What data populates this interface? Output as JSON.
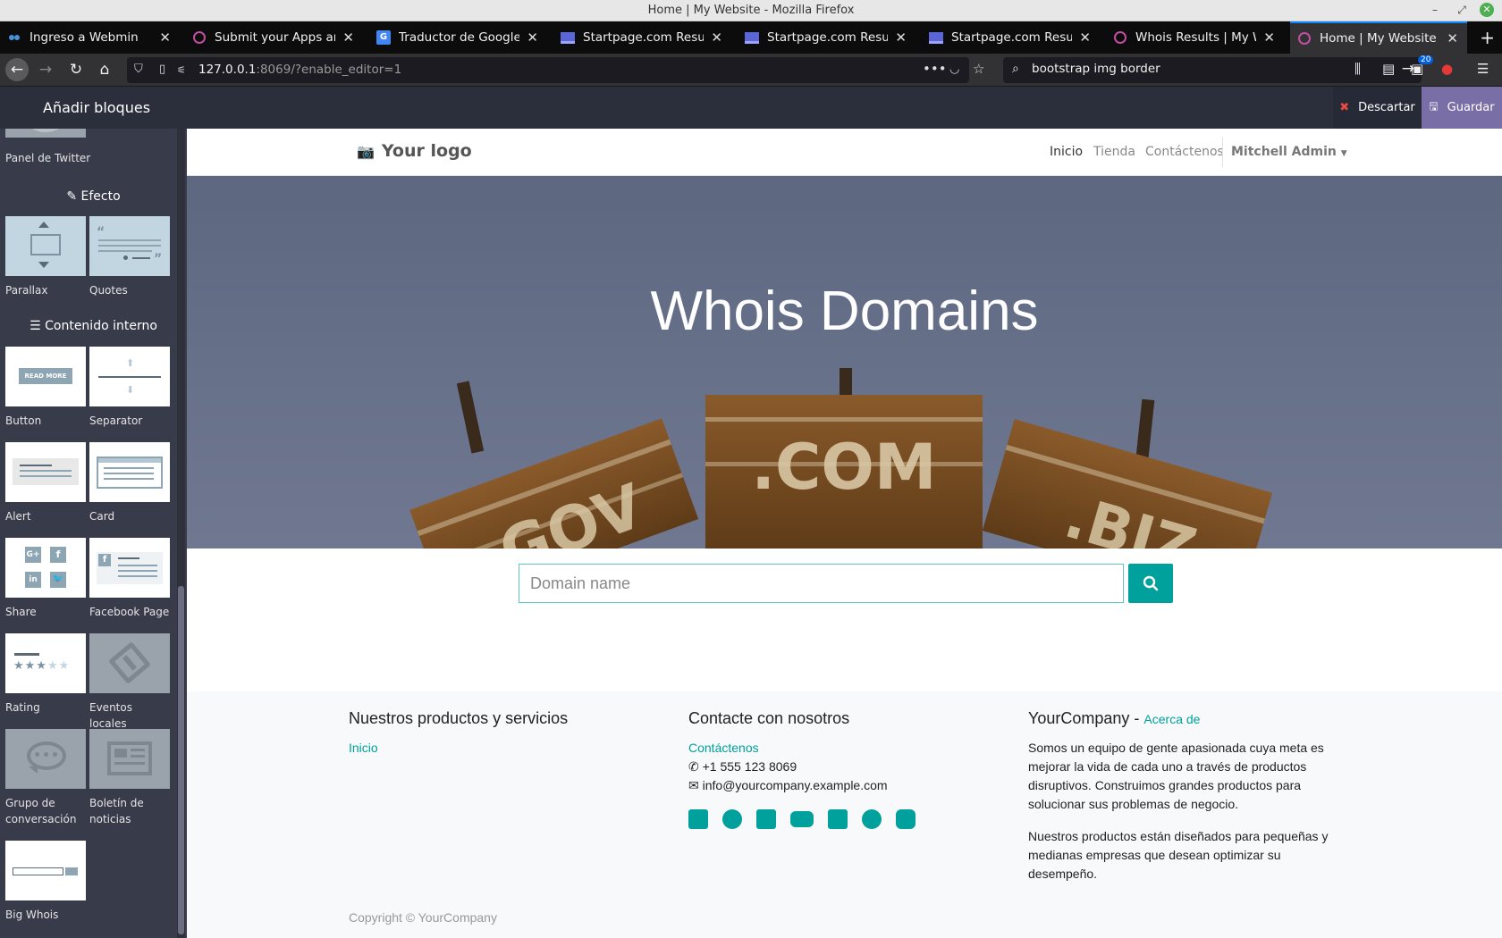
{
  "window": {
    "title": "Home | My Website - Mozilla Firefox"
  },
  "tabs": [
    {
      "label": "Ingreso a Webmin",
      "favicon": "webmin-icon"
    },
    {
      "label": "Submit your Apps and T",
      "favicon": "odoo-icon"
    },
    {
      "label": "Traductor de Google",
      "favicon": "google-translate-icon"
    },
    {
      "label": "Startpage.com Resultad",
      "favicon": "startpage-icon"
    },
    {
      "label": "Startpage.com Resultad",
      "favicon": "startpage-icon"
    },
    {
      "label": "Startpage.com Resultad",
      "favicon": "startpage-icon"
    },
    {
      "label": "Whois Results | My Web",
      "favicon": "odoo-icon"
    },
    {
      "label": "Home | My Website",
      "favicon": "odoo-icon",
      "active": true
    }
  ],
  "nav": {
    "url_host": "127.0.0.1",
    "url_rest": ":8069/?enable_editor=1",
    "search_value": "bootstrap img border",
    "badge": "20"
  },
  "editor": {
    "panel_title": "Añadir bloques",
    "discard_label": "Descartar",
    "save_label": "Guardar"
  },
  "sidebar": {
    "twitter_label": "Panel de Twitter",
    "cat_effect": "Efecto",
    "cat_inner": "Contenido interno",
    "snippets": {
      "parallax": "Parallax",
      "quotes": "Quotes",
      "button": "Button",
      "button_thumb": "READ MORE",
      "separator": "Separator",
      "alert": "Alert",
      "card": "Card",
      "share": "Share",
      "facebook": "Facebook Page",
      "rating": "Rating",
      "events": "Eventos locales",
      "group1": "Grupo de",
      "group2": "conversación",
      "newsletter1": "Boletín de",
      "newsletter2": "noticias",
      "bigwhois": "Big Whois"
    }
  },
  "site": {
    "logo": "Your logo",
    "menu": [
      "Inicio",
      "Tienda",
      "Contáctenos"
    ],
    "user": "Mitchell Admin",
    "hero_title": "Whois Domains",
    "domain_placeholder": "Domain name",
    "footer": {
      "col1_title": "Nuestros productos y servicios",
      "col1_link": "Inicio",
      "col2_title": "Contacte con nosotros",
      "col2_link": "Contáctenos",
      "phone": "+1 555 123 8069",
      "email": "info@yourcompany.example.com",
      "col3_title": "YourCompany",
      "col3_link": "Acerca de",
      "about_p1": "Somos un equipo de gente apasionada cuya meta es mejorar la vida de cada uno a través de productos disruptivos. Construimos grandes productos para solucionar sus problemas de negocio.",
      "about_p2": "Nuestros productos están diseñados para pequeñas y medianas empresas que desean optimizar su desempeño.",
      "social": [
        "facebook-icon",
        "twitter-icon",
        "linkedin-icon",
        "youtube-icon",
        "google-plus-icon",
        "github-icon",
        "instagram-icon"
      ],
      "copyright": "Copyright © YourCompany"
    }
  },
  "colors": {
    "accent": "#00a09d",
    "save": "#7a6ea6",
    "editor_bar": "#2b2e3b"
  }
}
